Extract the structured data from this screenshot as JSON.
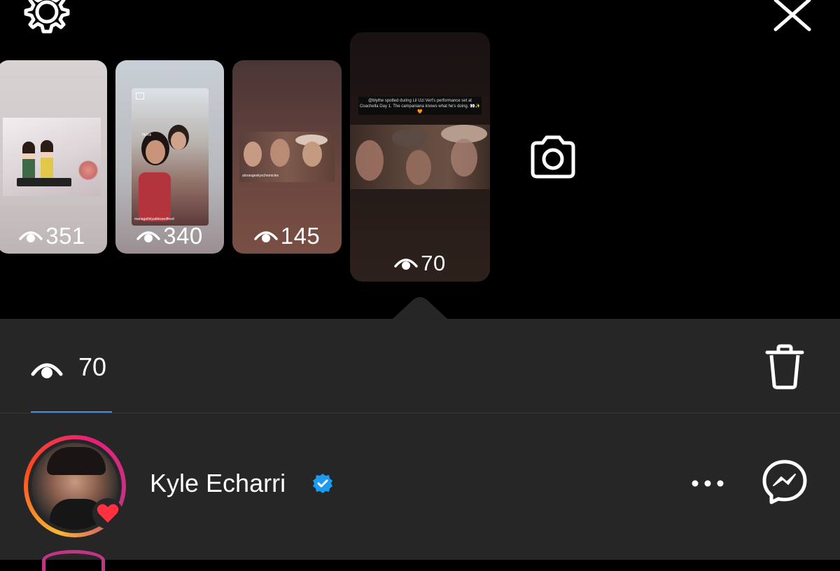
{
  "header": {
    "settings_icon": "gear-icon",
    "close_icon": "close-icon"
  },
  "stories": [
    {
      "views": "351"
    },
    {
      "views": "340"
    },
    {
      "views": "145"
    },
    {
      "views": "70",
      "selected": true,
      "caption": "@blythe spotted during Lil Uzi Vert's performance set at Coachella Day 1. The campaniana knows what he's doing. 👀✨🧡"
    }
  ],
  "story_text": {
    "story2_badge": "TikTok",
    "story2_handle": "mariagafoliyablessedfeed",
    "story3_handle": "alorangeskyxchronicles"
  },
  "camera_icon": "camera-icon",
  "sheet": {
    "views_count": "70",
    "trash_icon": "trash-icon"
  },
  "viewers": [
    {
      "name": "Kyle Echarri",
      "verified": true,
      "liked": true
    }
  ],
  "colors": {
    "background": "#000000",
    "sheet": "#262626",
    "accent_tab": "#4a8fd6",
    "verified": "#1d9bf0",
    "heart": "#ff3040"
  }
}
